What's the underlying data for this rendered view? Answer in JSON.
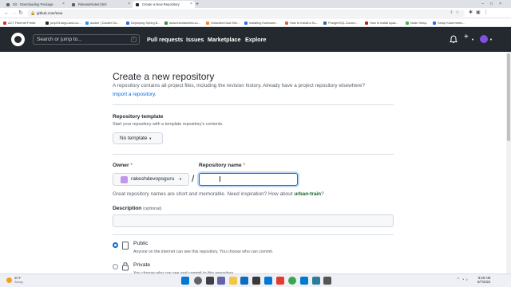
{
  "browser": {
    "tabs": [
      {
        "label": "Git - Downloading Package",
        "active": false
      },
      {
        "label": "ReleaseNotes.html",
        "active": false
      },
      {
        "label": "Create a New Repository",
        "active": true
      }
    ],
    "new_tab_glyph": "+",
    "url": "github.com/new",
    "bookmarks": [
      {
        "label": "ACT Fibernet Portal",
        "color": "#d0312d"
      },
      {
        "label": "jury201/argo-ansi-co...",
        "color": "#24292f"
      },
      {
        "label": "docker | Docker Do...",
        "color": "#2496ed"
      },
      {
        "label": "Deploying Spring B...",
        "color": "#2f6fcf"
      },
      {
        "label": "www.tutorialsinfra.co...",
        "color": "#3b8a3e"
      },
      {
        "label": "Unlocked Dual Sim...",
        "color": "#f08a24"
      },
      {
        "label": "Installing Kubeadm...",
        "color": "#326ce5"
      },
      {
        "label": "How to Install a Ku...",
        "color": "#e0623a"
      },
      {
        "label": "PostgreSQL Docum...",
        "color": "#336791"
      },
      {
        "label": "How to install Apac...",
        "color": "#b22222"
      },
      {
        "label": "Node Setup",
        "color": "#4caf50"
      },
      {
        "label": "Setup Kubernetes...",
        "color": "#326ce5"
      }
    ]
  },
  "github_header": {
    "search_placeholder": "Search or jump to...",
    "search_shortcut": "/",
    "nav": [
      "Pull requests",
      "Issues",
      "Marketplace",
      "Explore"
    ],
    "plus_glyph": "+"
  },
  "page": {
    "title": "Create a new repository",
    "intro": "A repository contains all project files, including the revision history. Already have a project repository elsewhere?",
    "import_link": "Import a repository.",
    "template": {
      "label": "Repository template",
      "help": "Start your repository with a template repository's contents.",
      "button": "No template"
    },
    "owner": {
      "label": "Owner",
      "required_mark": "*",
      "value": "rakeshdevopsguru"
    },
    "separator": "/",
    "repo_name": {
      "label": "Repository name",
      "required_mark": "*",
      "value": ""
    },
    "names_hint_prefix": "Great repository names are short and memorable. Need inspiration? How about",
    "names_suggestion": "urban-train",
    "names_hint_suffix": "?",
    "description": {
      "label": "Description",
      "optional": "(optional)",
      "value": ""
    },
    "visibility": [
      {
        "label": "Public",
        "help": "Anyone on the internet can see this repository. You choose who can commit.",
        "checked": true
      },
      {
        "label": "Private",
        "help": "You choose who can see and commit to this repository.",
        "checked": false
      }
    ]
  },
  "taskbar": {
    "weather_temp": "30°F",
    "weather_desc": "Sunny",
    "time": "8:26 AM",
    "date": "6/7/2022"
  },
  "colors": {
    "header_bg": "#24292f",
    "link": "#0969da",
    "suggestion": "#116329",
    "required": "#cf222e"
  }
}
